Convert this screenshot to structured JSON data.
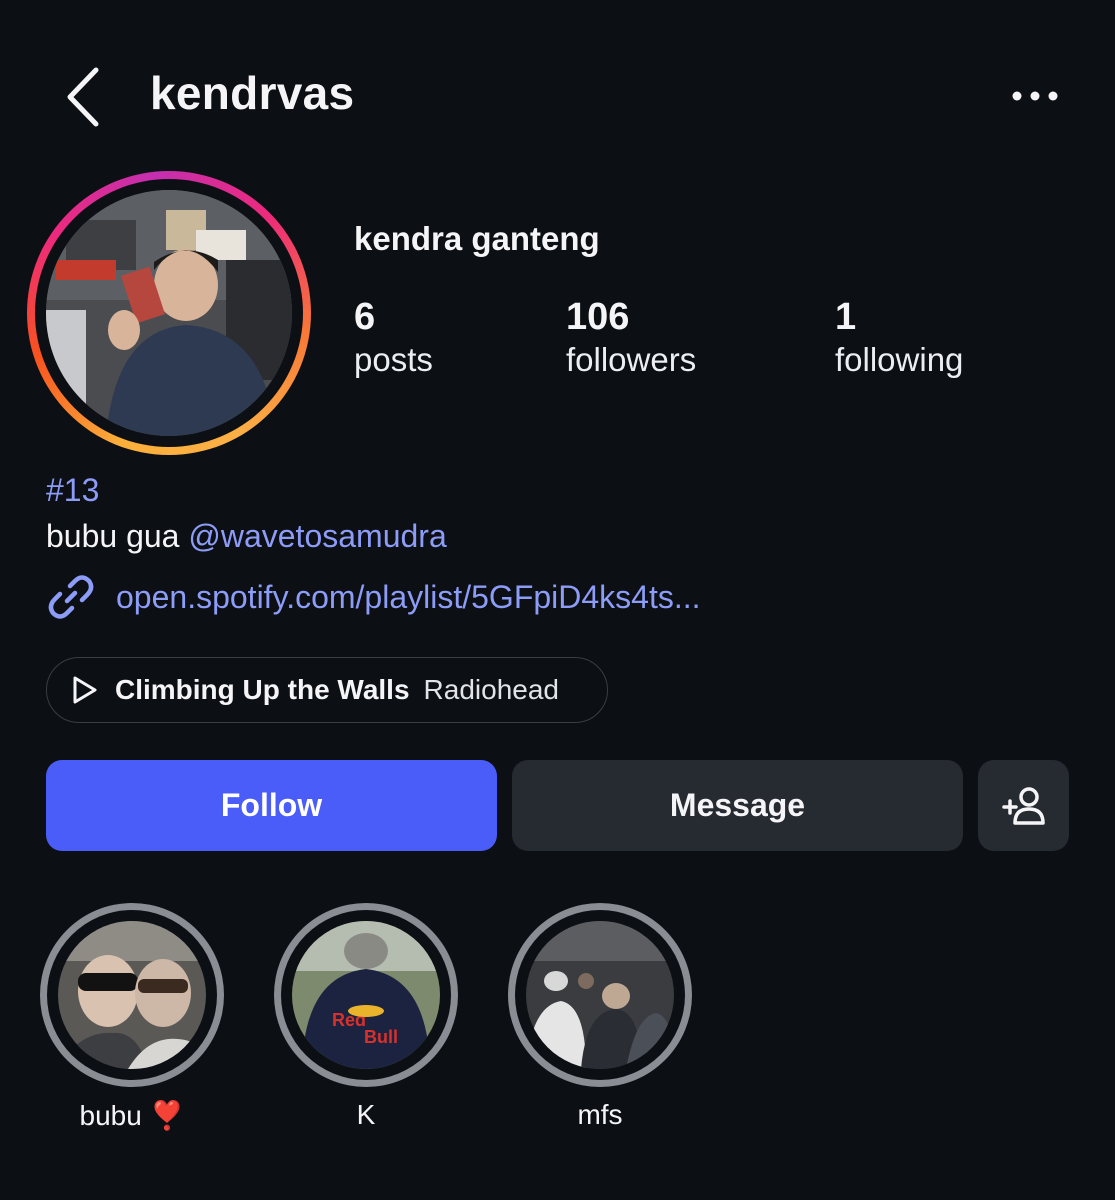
{
  "header": {
    "username": "kendrvas",
    "back_icon": "chevron-left-icon",
    "more_icon": "more-horizontal-icon"
  },
  "profile": {
    "full_name": "kendra ganteng",
    "stats": [
      {
        "count": "6",
        "label": "posts"
      },
      {
        "count": "106",
        "label": "followers"
      },
      {
        "count": "1",
        "label": "following"
      }
    ]
  },
  "bio": {
    "hashtag": "#13",
    "text": "bubu gua",
    "mention": "@wavetosamudra",
    "link": "open.spotify.com/playlist/5GFpiD4ks4ts..."
  },
  "music": {
    "song": "Climbing Up the Walls",
    "artist": "Radiohead"
  },
  "actions": {
    "follow_label": "Follow",
    "message_label": "Message",
    "add_user_icon": "add-user-icon"
  },
  "highlights": [
    {
      "label": "bubu ❣️"
    },
    {
      "label": "K"
    },
    {
      "label": "mfs"
    }
  ],
  "colors": {
    "background": "#0c0f14",
    "accent_blue": "#4a5df9",
    "link_blue": "#8c9cf7",
    "secondary_button": "#262a31"
  }
}
